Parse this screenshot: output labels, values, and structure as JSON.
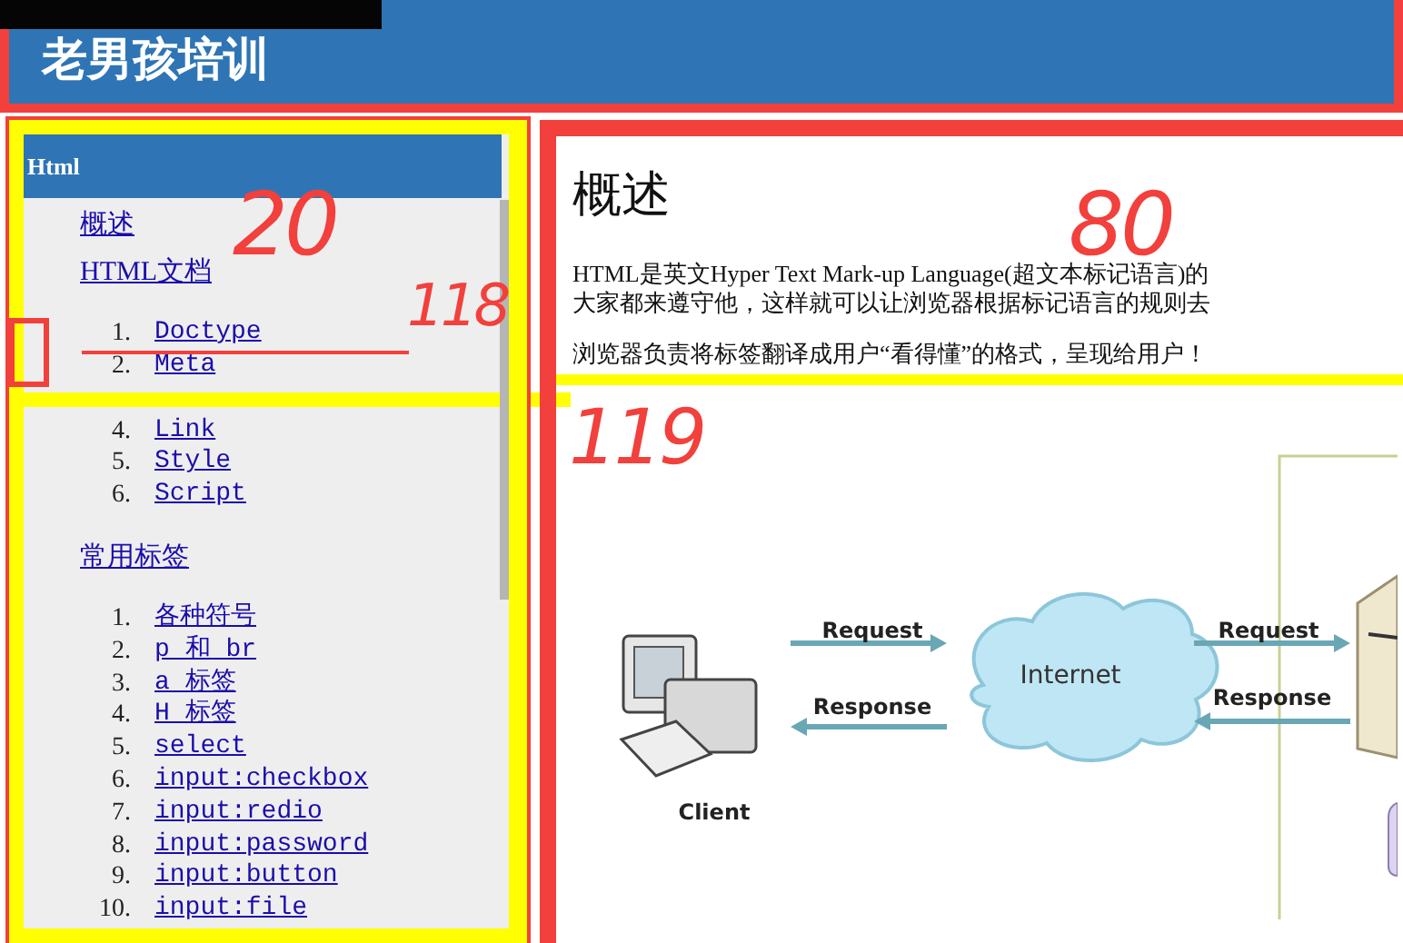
{
  "header": {
    "title": "老男孩培训"
  },
  "sidebar": {
    "title": "Html",
    "links": [
      {
        "label": "概述"
      },
      {
        "label": "HTML文档",
        "children": [
          {
            "number": "1.",
            "label": "Doctype"
          },
          {
            "number": "2.",
            "label": "Meta"
          },
          {
            "number": "4.",
            "label": "Link"
          },
          {
            "number": "5.",
            "label": "Style"
          },
          {
            "number": "6.",
            "label": "Script"
          }
        ]
      },
      {
        "label": "常用标签",
        "children": [
          {
            "number": "1.",
            "label": "各种符号"
          },
          {
            "number": "2.",
            "label": "p 和 br"
          },
          {
            "number": "3.",
            "label": "a 标签"
          },
          {
            "number": "4.",
            "label": "H 标签"
          },
          {
            "number": "5.",
            "label": "select"
          },
          {
            "number": "6.",
            "label": "input:checkbox"
          },
          {
            "number": "7.",
            "label": "input:redio"
          },
          {
            "number": "8.",
            "label": "input:password"
          },
          {
            "number": "9.",
            "label": "input:button"
          },
          {
            "number": "10.",
            "label": "input:file"
          }
        ]
      }
    ]
  },
  "article": {
    "title": "概述",
    "paragraphs": [
      "HTML是英文Hyper Text Mark-up Language(超文本标记语言)的",
      "大家都来遵守他，这样就可以让浏览器根据标记语言的规则去",
      "浏览器负责将标签翻译成用户“看得懂”的格式，呈现给用户！"
    ],
    "diagram": {
      "client_label": "Client",
      "cloud_label": "Internet",
      "arrows": [
        {
          "label": "Request"
        },
        {
          "label": "Response"
        },
        {
          "label": "Request"
        },
        {
          "label": "Response"
        }
      ]
    }
  },
  "annotations": [
    {
      "text": "20"
    },
    {
      "text": "118"
    },
    {
      "text": "80"
    },
    {
      "text": "119"
    }
  ]
}
